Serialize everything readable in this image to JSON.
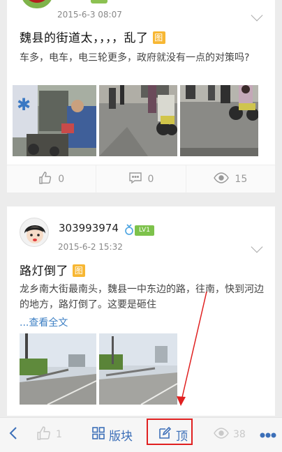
{
  "post1": {
    "date": "2015-6-3 08:07",
    "title": "魏县的街道太，，，，乱了",
    "tag": "图",
    "excerpt": "车多，电车，电三轮更多，政府就没有一点的对策吗?",
    "actions": {
      "likes": "0",
      "comments": "0",
      "views": "15"
    }
  },
  "post2": {
    "username": "303993974",
    "level": "LV1",
    "date": "2015-6-2 15:32",
    "title": "路灯倒了",
    "tag": "图",
    "excerpt": "龙乡南大街最南头，魏县一中东边的路，往南，快到河边的地方，路灯倒了。这要是砸住",
    "read_more": "...查看全文"
  },
  "bottom_bar": {
    "likes": "1",
    "board_label": "版块",
    "top_label": "顶",
    "views": "38"
  },
  "icons": {
    "like": "thumbs-up-icon",
    "comment": "comment-icon",
    "view": "eye-icon",
    "back": "back-chevron-icon",
    "board": "grid-icon",
    "edit": "edit-icon",
    "more": "more-dots-icon"
  },
  "colors": {
    "accent": "#3c6fb8",
    "tag": "#f7b733",
    "level": "#7dc24b",
    "annotation": "#e02020"
  }
}
